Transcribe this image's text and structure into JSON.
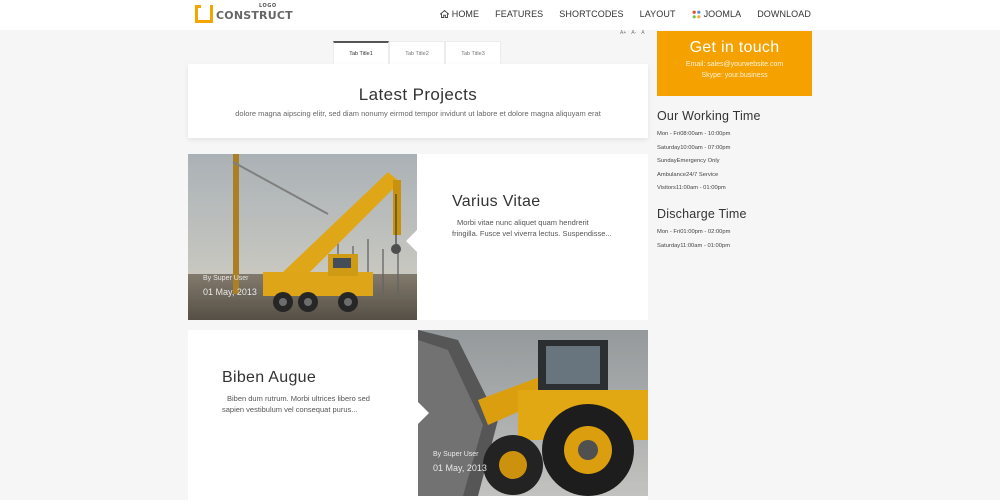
{
  "header": {
    "logo_small": "LOGO",
    "logo_text": "CONSTRUCT",
    "nav": [
      {
        "label": "HOME",
        "icon": "home-icon"
      },
      {
        "label": "FEATURES"
      },
      {
        "label": "SHORTCODES"
      },
      {
        "label": "LAYOUT"
      },
      {
        "label": "JOOMLA",
        "icon": "joomla-icon"
      },
      {
        "label": "DOWNLOAD"
      }
    ]
  },
  "font_size_controls": [
    "A+",
    "A-",
    "A"
  ],
  "tabs": [
    "Tab Title1",
    "Tab Title2",
    "Tab Title3"
  ],
  "latest": {
    "title": "Latest Projects",
    "subtitle": "dolore magna aipscing elitr, sed diam nonumy eirmod tempor invidunt ut labore et dolore magna aliquyam erat"
  },
  "projects": [
    {
      "title": "Varius Vitae",
      "description_line1": "Morbi vitae nunc aliquet quam hendrerit",
      "description_line2": "fringilla. Fusce vel viverra lectus. Suspendisse...",
      "author": "By Super User",
      "date": "01 May, 2013"
    },
    {
      "title": "Biben Augue",
      "description_line1": "Biben dum rutrum. Morbi ultrices libero sed",
      "description_line2": "sapien vestibulum vel consequat purus...",
      "author": "By Super User",
      "date": "01 May, 2013"
    }
  ],
  "contact": {
    "title": "Get in touch",
    "email": "Email: sales@yourwebsite.com",
    "skype": "Skype: your.business"
  },
  "working_time": {
    "title": "Our Working Time",
    "items": [
      "Mon - Fri08:00am - 10:00pm",
      "Saturday10:00am - 07:00pm",
      "SundayEmergency Only",
      "Ambulance24/7 Service",
      "Visitors11:00am - 01:00pm"
    ]
  },
  "discharge_time": {
    "title": "Discharge Time",
    "items": [
      "Mon - Fri01:00pm - 02:00pm",
      "Saturday11:00am - 01:00pm"
    ]
  },
  "colors": {
    "accent": "#f5a100",
    "text": "#333333",
    "background": "#f6f6f6"
  }
}
